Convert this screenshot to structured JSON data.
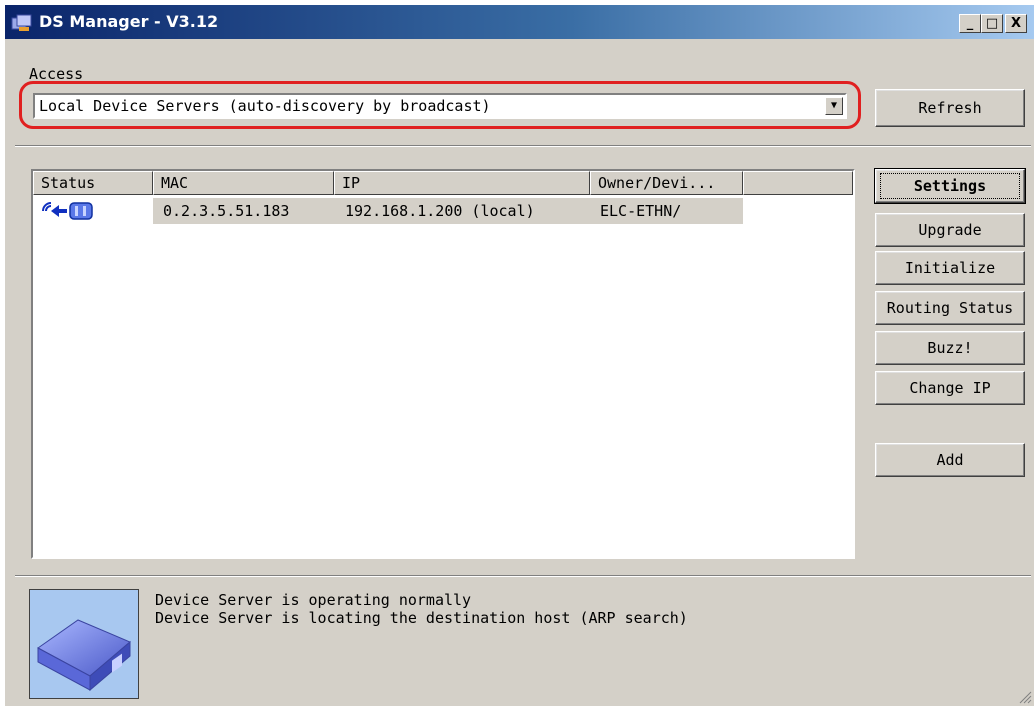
{
  "window": {
    "title": "DS Manager - V3.12",
    "controls": {
      "minimize": "_",
      "maximize": "□",
      "close": "X"
    }
  },
  "access": {
    "label": "Access",
    "selected": "Local Device Servers (auto-discovery by broadcast)",
    "refresh_label": "Refresh"
  },
  "table": {
    "columns": [
      "Status",
      "MAC",
      "IP",
      "Owner/Devi..."
    ],
    "rows": [
      {
        "status_icon": "network-device-status-icon",
        "mac": "0.2.3.5.51.183",
        "ip": "192.168.1.200 (local)",
        "owner": "ELC-ETHN/"
      }
    ]
  },
  "buttons": {
    "settings": "Settings",
    "upgrade": "Upgrade",
    "initialize": "Initialize",
    "routing_status": "Routing Status",
    "buzz": "Buzz!",
    "change_ip": "Change IP",
    "add": "Add"
  },
  "status": {
    "line1": "Device Server is operating normally",
    "line2": "Device Server is locating the destination host (ARP search)"
  },
  "colors": {
    "face": "#d4d0c8",
    "title_start": "#0a246a",
    "title_end": "#a6caf0",
    "highlight": "#e02020",
    "device_blue": "#6d7ee0"
  }
}
